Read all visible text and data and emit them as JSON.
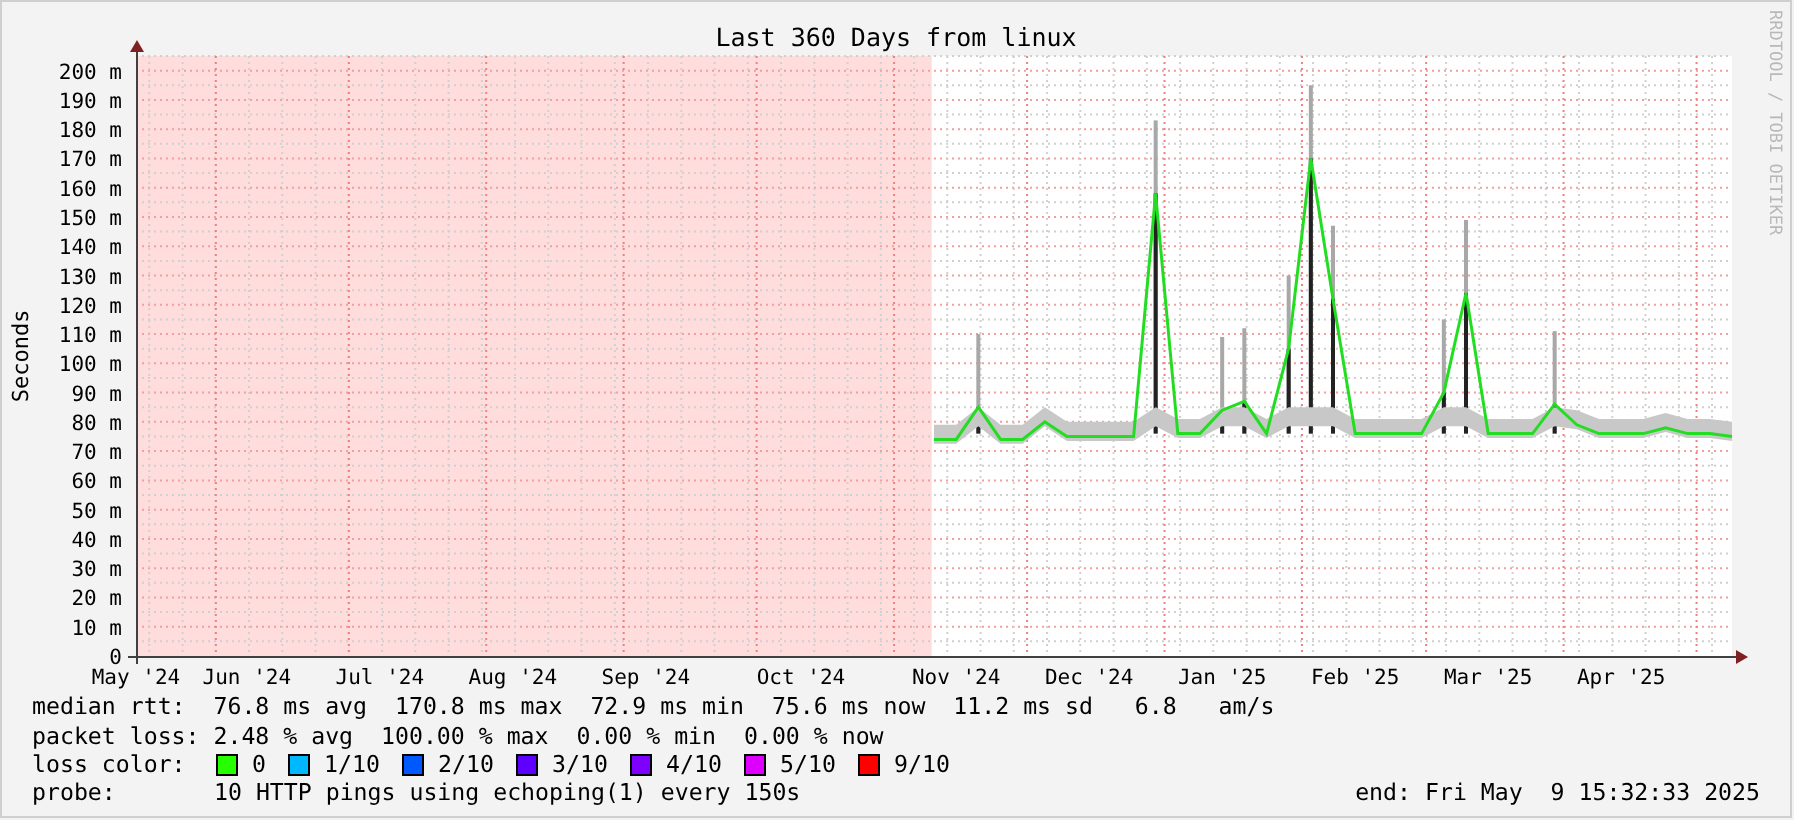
{
  "graph": {
    "watermark": "RRDTOOL / TOBI OETIKER",
    "chart_data": {
      "type": "line",
      "title": "Last 360 Days from linux",
      "ylabel": "Seconds",
      "categories": [
        "May '24",
        null,
        null,
        null,
        null,
        "Jun '24",
        null,
        null,
        null,
        null,
        null,
        "Jul '24",
        null,
        null,
        null,
        null,
        null,
        "Aug '24",
        null,
        null,
        null,
        null,
        null,
        "Sep '24",
        null,
        null,
        null,
        null,
        null,
        null,
        "Oct '24",
        null,
        null,
        null,
        null,
        null,
        null,
        "Nov '24",
        null,
        null,
        null,
        null,
        null,
        "Dec '24",
        null,
        null,
        null,
        null,
        null,
        "Jan '25",
        null,
        null,
        null,
        null,
        null,
        "Feb '25",
        null,
        null,
        null,
        null,
        null,
        "Mar '25",
        null,
        null,
        null,
        null,
        null,
        "Apr '25",
        null,
        null,
        null,
        null,
        null
      ],
      "grid": true,
      "series": [
        {
          "color": "#22dd22",
          "values": [
            null,
            null,
            null,
            null,
            null,
            null,
            null,
            null,
            null,
            null,
            null,
            null,
            null,
            null,
            null,
            null,
            null,
            null,
            null,
            null,
            null,
            null,
            null,
            null,
            null,
            null,
            null,
            null,
            null,
            null,
            null,
            null,
            null,
            null,
            null,
            null,
            74,
            74,
            85,
            74,
            74,
            80,
            75,
            75,
            75,
            75,
            158,
            76,
            76,
            84,
            87,
            76,
            105,
            170,
            122,
            76,
            76,
            76,
            76,
            90,
            124,
            76,
            76,
            76,
            86,
            79,
            76,
            76,
            76,
            78,
            76,
            76,
            75
          ]
        }
      ],
      "ylim": [
        0,
        205
      ],
      "yticks": [
        {
          "value": 0,
          "label": "0"
        },
        {
          "value": 10,
          "label": "10 m"
        },
        {
          "value": 20,
          "label": "20 m"
        },
        {
          "value": 30,
          "label": "30 m"
        },
        {
          "value": 40,
          "label": "40 m"
        },
        {
          "value": 50,
          "label": "50 m"
        },
        {
          "value": 60,
          "label": "60 m"
        },
        {
          "value": 70,
          "label": "70 m"
        },
        {
          "value": 80,
          "label": "80 m"
        },
        {
          "value": 90,
          "label": "90 m"
        },
        {
          "value": 100,
          "label": "100 m"
        },
        {
          "value": 110,
          "label": "110 m"
        },
        {
          "value": 120,
          "label": "120 m"
        },
        {
          "value": 130,
          "label": "130 m"
        },
        {
          "value": 140,
          "label": "140 m"
        },
        {
          "value": 150,
          "label": "150 m"
        },
        {
          "value": 160,
          "label": "160 m"
        },
        {
          "value": 170,
          "label": "170 m"
        },
        {
          "value": 180,
          "label": "180 m"
        },
        {
          "value": 190,
          "label": "190 m"
        },
        {
          "value": 200,
          "label": "200 m"
        }
      ]
    }
  },
  "legend": {
    "median_rtt": "median rtt:  76.8 ms avg  170.8 ms max  72.9 ms min  75.6 ms now  11.2 ms sd   6.8   am/s",
    "packet_loss": "packet loss: 2.48 % avg  100.00 % max  0.00 % min  0.00 % now",
    "loss_color_label": "loss color:",
    "loss_colors": [
      {
        "label": "0",
        "color": "#26ff00"
      },
      {
        "label": "1/10",
        "color": "#00b8ff"
      },
      {
        "label": "2/10",
        "color": "#0059ff"
      },
      {
        "label": "3/10",
        "color": "#5e00ff"
      },
      {
        "label": "4/10",
        "color": "#7e00ff"
      },
      {
        "label": "5/10",
        "color": "#dd00ff"
      },
      {
        "label": "9/10",
        "color": "#ff0000"
      }
    ],
    "probe_label": "probe:",
    "probe": "10 HTTP pings using echoping(1) every 150s",
    "end": "end: Fri May  9 15:32:33 2025"
  }
}
